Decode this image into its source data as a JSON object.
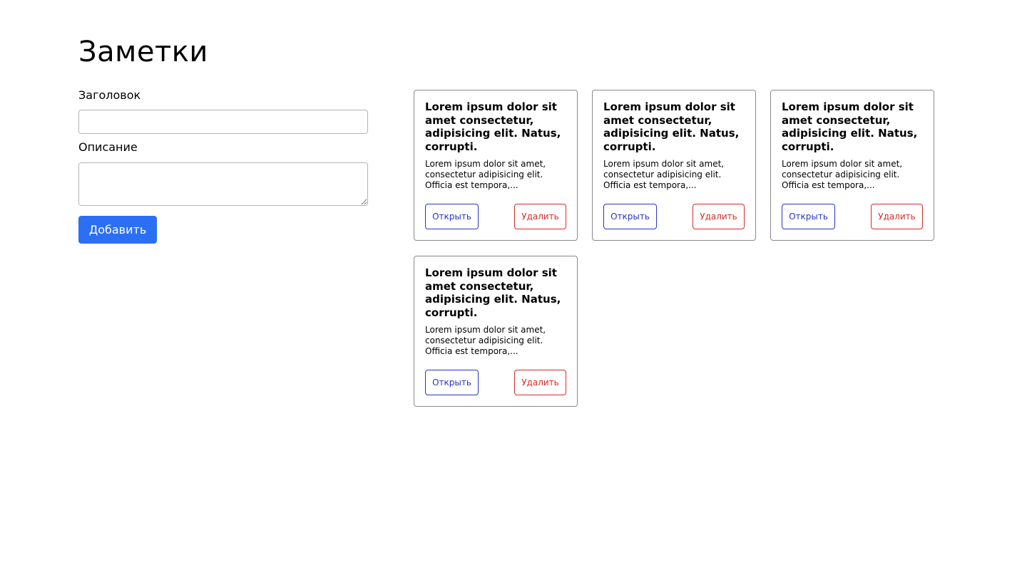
{
  "page": {
    "title": "Заметки"
  },
  "form": {
    "title_label": "Заголовок",
    "title_value": "",
    "description_label": "Описание",
    "description_value": "",
    "add_button_label": "Добавить"
  },
  "colors": {
    "primary": "#2b6ff5",
    "open_accent": "#2a33c7",
    "delete_accent": "#d62a2a"
  },
  "notes": [
    {
      "title": "Lorem ipsum dolor sit amet consectetur, adipisicing elit. Natus, corrupti.",
      "description": "Lorem ipsum dolor sit amet, consectetur adipisicing elit. Officia est tempora,...",
      "open_label": "Открыть",
      "delete_label": "Удалить"
    },
    {
      "title": "Lorem ipsum dolor sit amet consectetur, adipisicing elit. Natus, corrupti.",
      "description": "Lorem ipsum dolor sit amet, consectetur adipisicing elit. Officia est tempora,...",
      "open_label": "Открыть",
      "delete_label": "Удалить"
    },
    {
      "title": "Lorem ipsum dolor sit amet consectetur, adipisicing elit. Natus, corrupti.",
      "description": "Lorem ipsum dolor sit amet, consectetur adipisicing elit. Officia est tempora,...",
      "open_label": "Открыть",
      "delete_label": "Удалить"
    },
    {
      "title": "Lorem ipsum dolor sit amet consectetur, adipisicing elit. Natus, corrupti.",
      "description": "Lorem ipsum dolor sit amet, consectetur adipisicing elit. Officia est tempora,...",
      "open_label": "Открыть",
      "delete_label": "Удалить"
    }
  ]
}
